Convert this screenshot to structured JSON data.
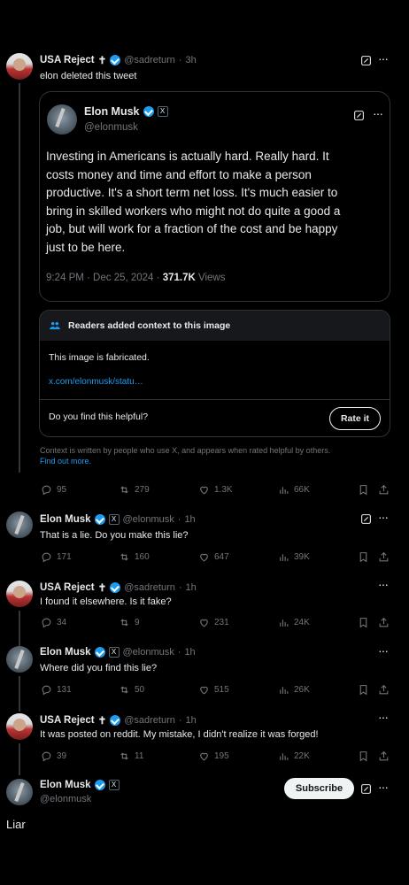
{
  "tweet1": {
    "name": "USA Reject",
    "name_suffix": "✝",
    "handle": "@sadreturn",
    "time": "3h",
    "text": "elon deleted this tweet",
    "quote": {
      "name": "Elon Musk",
      "handle": "@elonmusk",
      "lines": [
        "Investing in Americans is actually hard. Really hard. It",
        "costs money and time and effort to make a person",
        "productive. It's a short term net loss. It's much easier to",
        "bring in skilled workers who might not do quite a good a",
        "job, but will work for a fraction of the cost and be happy",
        "just to be here."
      ],
      "date": "9:24 PM · Dec 25, 2024 · ",
      "views_value": "371.7K",
      "views_label": " Views"
    },
    "note": {
      "header": "Readers added context to this image",
      "body": "This image is fabricated.",
      "link": "x.com/elonmusk/statu…",
      "question": "Do you find this helpful?",
      "rate_label": "Rate it",
      "footer_line1": "Context is written by people who use X, and appears when rated helpful by others.",
      "footer_link": "Find out more."
    },
    "stats": {
      "replies": "95",
      "reposts": "279",
      "likes": "1.3K",
      "views": "66K"
    }
  },
  "tweet2": {
    "name": "Elon Musk",
    "handle": "@elonmusk",
    "time": "1h",
    "text": "That is a lie. Do you make this lie?",
    "stats": {
      "replies": "171",
      "reposts": "160",
      "likes": "647",
      "views": "39K"
    }
  },
  "tweet3": {
    "name": "USA Reject",
    "name_suffix": "✝",
    "handle": "@sadreturn",
    "time": "1h",
    "text": "I found it elsewhere. Is it fake?",
    "stats": {
      "replies": "34",
      "reposts": "9",
      "likes": "231",
      "views": "24K"
    }
  },
  "tweet4": {
    "name": "Elon Musk",
    "handle": "@elonmusk",
    "time": "1h",
    "text": "Where did you find this lie?",
    "stats": {
      "replies": "131",
      "reposts": "50",
      "likes": "515",
      "views": "26K"
    }
  },
  "tweet5": {
    "name": "USA Reject",
    "name_suffix": "✝",
    "handle": "@sadreturn",
    "time": "1h",
    "text": "It was posted on reddit. My mistake, I didn't realize it was forged!",
    "stats": {
      "replies": "39",
      "reposts": "11",
      "likes": "195",
      "views": "22K"
    }
  },
  "tweet6": {
    "name": "Elon Musk",
    "handle": "@elonmusk",
    "subscribe_label": "Subscribe",
    "text": "Liar"
  },
  "separator": " · ",
  "x_glyph": "X",
  "colors": {
    "accent": "#1d9bf0",
    "muted": "#71767b",
    "border": "#2f3336",
    "text": "#e7e9ea"
  }
}
